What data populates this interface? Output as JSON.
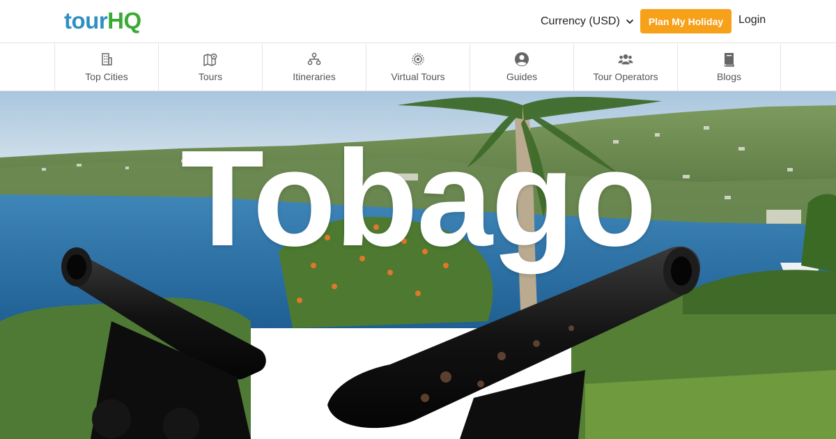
{
  "header": {
    "logo": {
      "part1": "to",
      "part2": "ur",
      "part3": "HQ"
    },
    "currency_label": "Currency (USD)",
    "plan_button": "Plan My Holiday",
    "login_label": "Login"
  },
  "nav": {
    "items": [
      {
        "label": "Top Cities",
        "icon": "building-icon"
      },
      {
        "label": "Tours",
        "icon": "map-pin-icon"
      },
      {
        "label": "Itineraries",
        "icon": "sitemap-icon"
      },
      {
        "label": "Virtual Tours",
        "icon": "vr-icon"
      },
      {
        "label": "Guides",
        "icon": "user-circle-icon"
      },
      {
        "label": "Tour Operators",
        "icon": "users-icon"
      },
      {
        "label": "Blogs",
        "icon": "book-icon"
      }
    ]
  },
  "hero": {
    "title": "Tobago",
    "image": "tropical bay with palm tree and two black cannons"
  },
  "colors": {
    "accent": "#f7a11a",
    "logo_blue": "#2f8fc3",
    "logo_green": "#3aaa35"
  }
}
